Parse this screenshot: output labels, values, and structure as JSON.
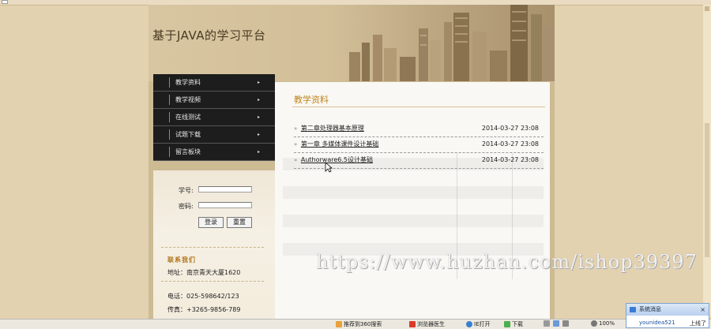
{
  "site": {
    "title": "基于JAVA的学习平台"
  },
  "nav": {
    "items": [
      {
        "label": "教学资料"
      },
      {
        "label": "教学视频"
      },
      {
        "label": "在线测试"
      },
      {
        "label": "试题下载"
      },
      {
        "label": "留言板块"
      }
    ],
    "arrow": "▸"
  },
  "login": {
    "student_id_label": "学号:",
    "password_label": "密码:",
    "student_id_value": "",
    "password_value": "",
    "submit_label": "登录",
    "reset_label": "重置"
  },
  "contact": {
    "title": "联系我们",
    "address": "地址：南京青天大厦1620",
    "phone": "电话：025-598642/123",
    "fax": "传真：+3265-9856-789"
  },
  "main": {
    "title": "教学资料",
    "items": [
      {
        "arrow": "»",
        "title": "第二章处理器基本原理",
        "date": "2014-03-27 23:08"
      },
      {
        "arrow": "»",
        "title": "第一章 多媒体课件设计基础",
        "date": "2014-03-27 23:08"
      },
      {
        "arrow": "»",
        "title": "Authorware6.5设计基础",
        "date": "2014-03-27 23:08"
      }
    ]
  },
  "watermark": "https://www.huzhan.com/ishop39397",
  "statusbar": {
    "item1": "推荐到360搜索",
    "item2": "浏览器医生",
    "item3": "IE打开",
    "item4": "下载",
    "zoom": "100%"
  },
  "popup": {
    "title": "系统消息",
    "close": "×",
    "user": "younidea521",
    "status": "上线了"
  },
  "colors": {
    "accent": "#c0851f",
    "nav_bg": "#1d1d1d",
    "page_bg": "#e3d2b0"
  }
}
